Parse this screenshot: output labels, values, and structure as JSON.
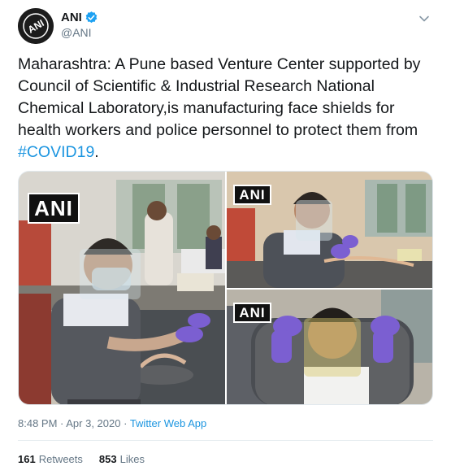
{
  "author": {
    "display_name": "ANI",
    "handle": "@ANI",
    "verified": true,
    "avatar_text": "ANI"
  },
  "tweet": {
    "text": "Maharashtra: A Pune based Venture Center supported by Council of Scientific & Industrial Research National Chemical Laboratory,is manufacturing face shields for health workers and police personnel to protect them from ",
    "hashtag": "#COVID19",
    "trailing": "."
  },
  "media": {
    "watermark": "ANI"
  },
  "meta": {
    "time": "8:48 PM",
    "separator1": " · ",
    "date": "Apr 3, 2020",
    "separator2": " · ",
    "source": "Twitter Web App"
  },
  "stats": {
    "retweets_count": "161",
    "retweets_label": "Retweets",
    "likes_count": "853",
    "likes_label": "Likes"
  },
  "icons": {
    "avatar": "ani-logo-icon",
    "verified": "verified-badge-icon",
    "menu": "chevron-down-icon"
  },
  "colors": {
    "link": "#1b95e0",
    "muted": "#657786",
    "text": "#14171a",
    "verified": "#1da1f2"
  }
}
